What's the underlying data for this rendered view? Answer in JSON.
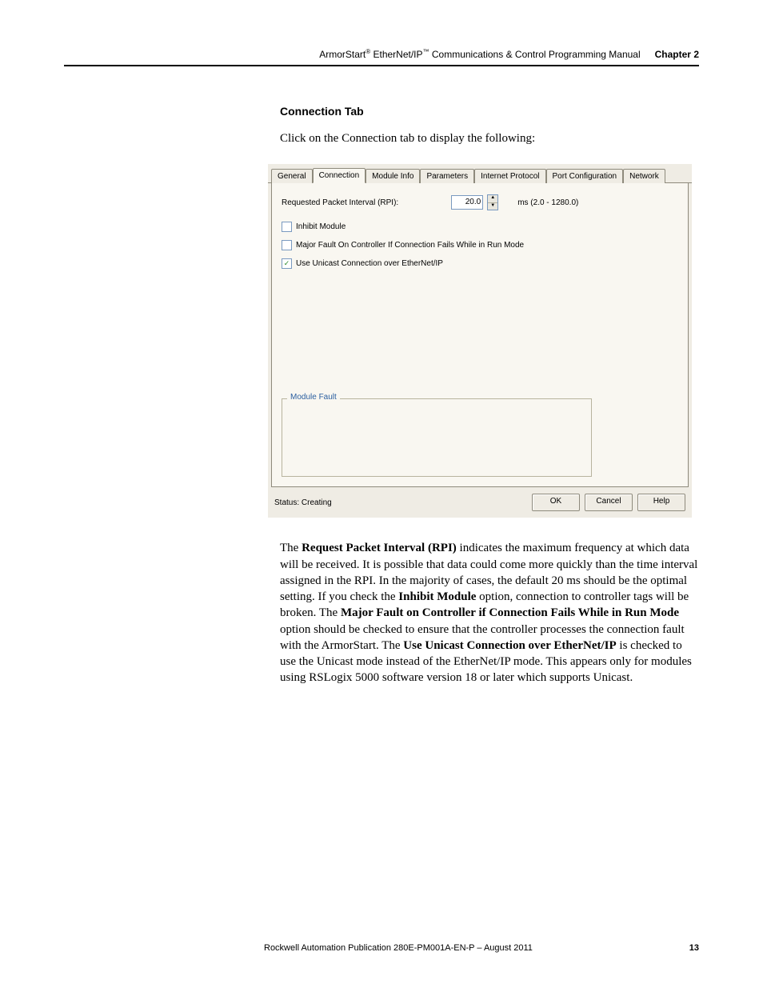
{
  "header": {
    "title_prefix": "ArmorStart",
    "sup1": "®",
    "title_mid": " EtherNet/IP",
    "sup2": "™",
    "title_suffix": " Communications & Control Programming Manual",
    "chapter": "Chapter 2"
  },
  "heading": "Connection Tab",
  "intro": "Click on the Connection tab to display the following:",
  "dialog": {
    "tabs": [
      "General",
      "Connection",
      "Module Info",
      "Parameters",
      "Internet Protocol",
      "Port Configuration",
      "Network"
    ],
    "active_tab_index": 1,
    "rpi_label": "Requested Packet Interval (RPI):",
    "rpi_value": "20.0",
    "rpi_range": "ms (2.0 - 1280.0)",
    "check_inhibit": "Inhibit Module",
    "check_inhibit_checked": false,
    "check_fault": "Major Fault On Controller If Connection Fails While in Run Mode",
    "check_fault_checked": false,
    "check_unicast": "Use Unicast Connection over EtherNet/IP",
    "check_unicast_checked": true,
    "fieldset_legend": "Module Fault",
    "status_label": "Status: Creating",
    "btn_ok": "OK",
    "btn_cancel": "Cancel",
    "btn_help": "Help"
  },
  "body": {
    "t1": "The ",
    "b1": "Request Packet Interval (RPI)",
    "t2": " indicates the maximum frequency at which data will be received. It is possible that data could come more quickly than the time interval assigned in the RPI. In the majority of cases, the default 20 ms should be the optimal setting. If you check the ",
    "b2": "Inhibit Module",
    "t3": " option, connection to controller tags will be broken. The ",
    "b3": "Major Fault on Controller if Connection Fails While in Run Mode",
    "t4": " option should be checked to ensure that the controller processes the connection fault with the ArmorStart. The ",
    "b4": "Use Unicast Connection over EtherNet/IP",
    "t5": " is checked to use the Unicast mode instead of the EtherNet/IP mode. This appears only for modules using RSLogix 5000 software version 18 or later which supports Unicast."
  },
  "footer": {
    "publication": "Rockwell Automation Publication 280E-PM001A-EN-P – August 2011",
    "page": "13"
  }
}
